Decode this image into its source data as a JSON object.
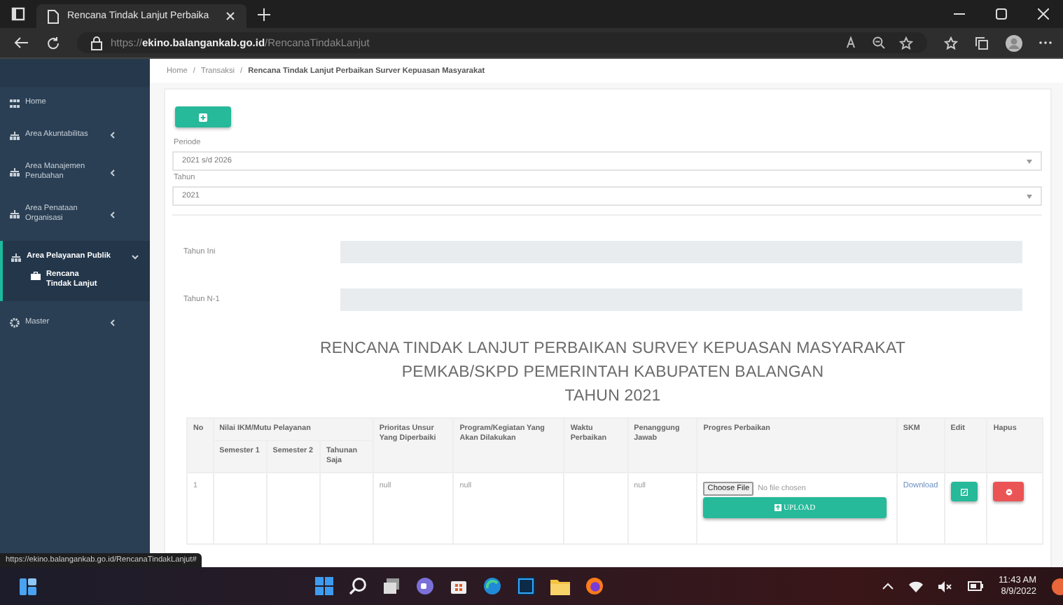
{
  "browser": {
    "tab_title": "Rencana Tindak Lanjut Perbaika",
    "url_scheme": "https://",
    "url_host": "ekino.balangankab.go.id",
    "url_path": "/RencanaTindakLanjut"
  },
  "breadcrumb": {
    "separator": "/",
    "items": [
      "Home",
      "Transaksi",
      "Rencana Tindak Lanjut Perbaikan Surver Kepuasan Masyarakat"
    ]
  },
  "sidebar": {
    "items": [
      {
        "label": "Home"
      },
      {
        "label": "Area Akuntabilitas",
        "expanded": false
      },
      {
        "label": "Area Manajemen Perubahan",
        "expanded": false
      },
      {
        "label": "Area Penataan Organisasi",
        "expanded": false
      },
      {
        "label": "Area Pelayanan Publik",
        "expanded": true,
        "children": [
          {
            "label": "Rencana Tindak Lanjut",
            "selected": true
          }
        ]
      },
      {
        "label": "Master",
        "expanded": false
      }
    ]
  },
  "form": {
    "periode": {
      "label": "Periode",
      "value": "2021 s/d 2026"
    },
    "tahun": {
      "label": "Tahun",
      "value": "2021"
    },
    "rows": [
      {
        "label": "Tahun Ini"
      },
      {
        "label": "Tahun N-1"
      }
    ]
  },
  "report_title": [
    "RENCANA TINDAK LANJUT PERBAIKAN SURVEY KEPUASAN MASYARAKAT",
    "PEMKAB/SKPD PEMERINTAH KABUPATEN BALANGAN",
    "TAHUN 2021"
  ],
  "table": {
    "columns": {
      "no": "No",
      "nilai": "Nilai IKM/Mutu Pelayanan",
      "nilai_sub": [
        "Semester 1",
        "Semester 2",
        "Tahunan Saja"
      ],
      "prioritas": "Prioritas Unsur Yang Diperbaiki",
      "program": "Program/Kegiatan Yang Akan Dilakukan",
      "waktu": "Waktu Perbaikan",
      "penanggung_jawab": "Penanggung Jawab",
      "progres": "Progres Perbaikan",
      "skm": "SKM",
      "edit": "Edit",
      "hapus": "Hapus"
    },
    "rows": [
      {
        "no": "1",
        "prioritas": "null",
        "program": "null",
        "penanggung_jawab": "null",
        "file_button": "Choose File",
        "file_status": "No file chosen",
        "upload": "UPLOAD",
        "skm_link": "Download"
      }
    ]
  },
  "status_bar": {
    "url": "https://ekino.balangankab.go.id/RencanaTindakLanjut#"
  },
  "taskbar": {
    "time": "11:43 AM",
    "date": "8/9/2022"
  }
}
